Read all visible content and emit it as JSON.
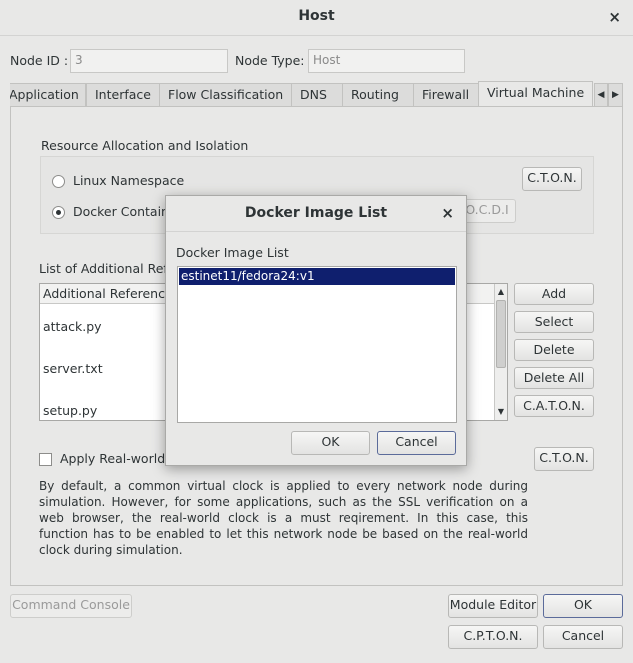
{
  "window": {
    "title": "Host",
    "close_glyph": "×"
  },
  "node": {
    "id_label": "Node ID :",
    "id_value": "3",
    "type_label": "Node Type:",
    "type_value": "Host"
  },
  "tabs": [
    {
      "label": "Application"
    },
    {
      "label": "Interface"
    },
    {
      "label": "Flow Classification"
    },
    {
      "label": "DNS"
    },
    {
      "label": "Routing"
    },
    {
      "label": "Firewall"
    },
    {
      "label": "Virtual Machine"
    }
  ],
  "tab_scroll": {
    "left": "◀",
    "right": "▶"
  },
  "resource": {
    "heading": "Resource Allocation and Isolation",
    "option1": "Linux Namespace",
    "option2": "Docker Containe",
    "selected": "option2",
    "cton_button": "C.T.O.N.",
    "ocdi_button": "O.C.D.I"
  },
  "additional_files": {
    "heading": "List of Additional Refe",
    "column_header": "Additional Reference",
    "files": [
      "attack.py",
      "server.txt",
      "setup.py"
    ],
    "buttons": {
      "add": "Add",
      "select": "Select",
      "delete": "Delete",
      "delete_all": "Delete All",
      "caton": "C.A.T.O.N."
    }
  },
  "realworld": {
    "checkbox_label": "Apply Real-world C",
    "checked": false,
    "cton_button": "C.T.O.N.",
    "description": "By default, a common virtual clock is applied to every network node during simulation. However, for some applications, such as the SSL verification on a web browser, the real-world clock is a must reqirement. In this case, this function has to be enabled to let this network node be based on the real-world clock during simulation."
  },
  "footer": {
    "command_console": "Command  Console",
    "module_editor": "Module Editor",
    "ok": "OK",
    "cpton": "C.P.T.O.N.",
    "cancel": "Cancel"
  },
  "dialog": {
    "title": "Docker Image List",
    "close_glyph": "×",
    "list_label": "Docker Image List",
    "images": [
      "estinet11/fedora24:v1"
    ],
    "selected_index": 0,
    "ok": "OK",
    "cancel": "Cancel"
  },
  "colors": {
    "selection": "#0f1f6e",
    "window_bg": "#e8e8e7"
  }
}
